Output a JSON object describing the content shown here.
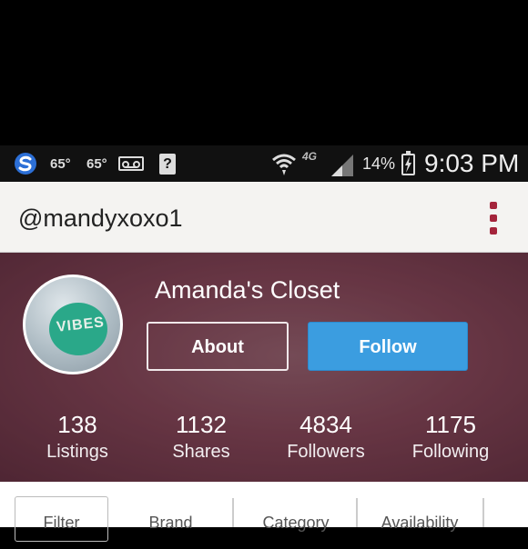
{
  "status_bar": {
    "temp1": "65°",
    "temp2": "65°",
    "unknown_icon": "?",
    "network": "4G",
    "battery": "14%",
    "time": "9:03 PM"
  },
  "app_bar": {
    "username": "@mandyxoxo1"
  },
  "profile": {
    "closet_name": "Amanda's Closet",
    "avatar_text": "VIBES",
    "about_label": "About",
    "follow_label": "Follow",
    "stats": [
      {
        "value": "138",
        "label": "Listings"
      },
      {
        "value": "1132",
        "label": "Shares"
      },
      {
        "value": "4834",
        "label": "Followers"
      },
      {
        "value": "1175",
        "label": "Following"
      }
    ]
  },
  "filters": {
    "items": [
      "Filter",
      "Brand",
      "Category",
      "Availability"
    ]
  },
  "colors": {
    "accent_menu": "#a4243b",
    "follow_button": "#3b9de0"
  }
}
